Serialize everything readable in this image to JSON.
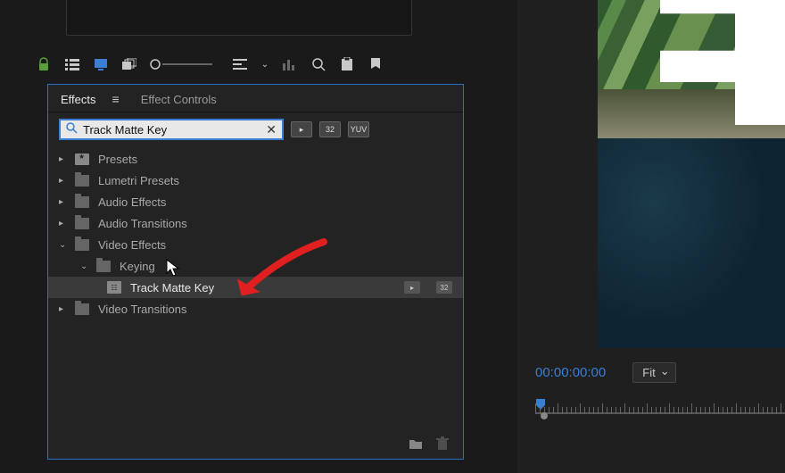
{
  "toolbar": {
    "icons": [
      "lock-icon",
      "list-icon",
      "monitor-active-icon",
      "stack-icon",
      "circle-icon",
      "align-icon",
      "bars-icon",
      "mag-icon",
      "clipboard-icon",
      "marker-icon"
    ]
  },
  "effects_panel": {
    "tabs": {
      "active": "Effects",
      "other": "Effect Controls"
    },
    "search": {
      "value": "Track Matte Key",
      "placeholder": ""
    },
    "filter_badges": [
      "▸",
      "32",
      "YUV"
    ],
    "tree": {
      "presets": "Presets",
      "lumetri": "Lumetri Presets",
      "audio_fx": "Audio Effects",
      "audio_tr": "Audio Transitions",
      "video_fx": "Video Effects",
      "keying": "Keying",
      "track_matte": "Track Matte Key",
      "video_tr": "Video Transitions"
    }
  },
  "program": {
    "timecode": "00:00:00:00",
    "fit_label": "Fit"
  },
  "colors": {
    "accent_blue": "#3a7fd5",
    "panel_bg": "#232323",
    "selection": "#3a3a3a"
  }
}
